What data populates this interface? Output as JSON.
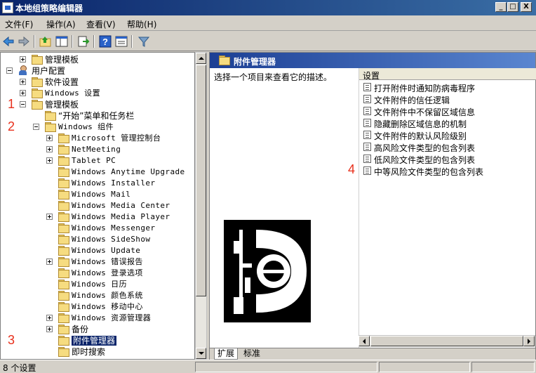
{
  "window": {
    "title": "本地组策略编辑器",
    "controls": {
      "minimize": "_",
      "maximize": "□",
      "close": "X"
    }
  },
  "menu": [
    {
      "label": "文件(F)"
    },
    {
      "label": "操作(A)"
    },
    {
      "label": "查看(V)"
    },
    {
      "label": "帮助(H)"
    }
  ],
  "toolbar": [
    "back-icon",
    "forward-icon",
    "up-folder-icon",
    "show-hide-tree-icon",
    "export-list-icon",
    "help-icon",
    "extended-view-icon",
    "filter-icon"
  ],
  "tree": {
    "nodes": [
      {
        "label": "管理模板",
        "indent": 1,
        "expander": "plus",
        "icon": "folder",
        "mono": false
      },
      {
        "label": "用户配置",
        "indent": 0,
        "expander": "minus",
        "icon": "user",
        "mono": false
      },
      {
        "label": "软件设置",
        "indent": 1,
        "expander": "plus",
        "icon": "folder",
        "mono": false
      },
      {
        "label": "Windows 设置",
        "indent": 1,
        "expander": "plus",
        "icon": "folder",
        "mono": true
      },
      {
        "label": "管理模板",
        "indent": 1,
        "expander": "minus",
        "icon": "folder",
        "mono": false
      },
      {
        "label": "“开始”菜单和任务栏",
        "indent": 2,
        "expander": "none",
        "icon": "folder",
        "mono": false
      },
      {
        "label": "Windows 组件",
        "indent": 2,
        "expander": "minus",
        "icon": "folder",
        "mono": true
      },
      {
        "label": "Microsoft 管理控制台",
        "indent": 3,
        "expander": "plus",
        "icon": "folder",
        "mono": true
      },
      {
        "label": "NetMeeting",
        "indent": 3,
        "expander": "plus",
        "icon": "folder",
        "mono": true
      },
      {
        "label": "Tablet PC",
        "indent": 3,
        "expander": "plus",
        "icon": "folder",
        "mono": true
      },
      {
        "label": "Windows Anytime Upgrade",
        "indent": 3,
        "expander": "none",
        "icon": "folder",
        "mono": true
      },
      {
        "label": "Windows Installer",
        "indent": 3,
        "expander": "none",
        "icon": "folder",
        "mono": true
      },
      {
        "label": "Windows Mail",
        "indent": 3,
        "expander": "none",
        "icon": "folder",
        "mono": true
      },
      {
        "label": "Windows Media Center",
        "indent": 3,
        "expander": "none",
        "icon": "folder",
        "mono": true
      },
      {
        "label": "Windows Media Player",
        "indent": 3,
        "expander": "plus",
        "icon": "folder",
        "mono": true
      },
      {
        "label": "Windows Messenger",
        "indent": 3,
        "expander": "none",
        "icon": "folder",
        "mono": true
      },
      {
        "label": "Windows SideShow",
        "indent": 3,
        "expander": "none",
        "icon": "folder",
        "mono": true
      },
      {
        "label": "Windows Update",
        "indent": 3,
        "expander": "none",
        "icon": "folder",
        "mono": true
      },
      {
        "label": "Windows 错误报告",
        "indent": 3,
        "expander": "plus",
        "icon": "folder",
        "mono": true
      },
      {
        "label": "Windows 登录选项",
        "indent": 3,
        "expander": "none",
        "icon": "folder",
        "mono": true
      },
      {
        "label": "Windows 日历",
        "indent": 3,
        "expander": "none",
        "icon": "folder",
        "mono": true
      },
      {
        "label": "Windows 颜色系统",
        "indent": 3,
        "expander": "none",
        "icon": "folder",
        "mono": true
      },
      {
        "label": "Windows 移动中心",
        "indent": 3,
        "expander": "none",
        "icon": "folder",
        "mono": true
      },
      {
        "label": "Windows 资源管理器",
        "indent": 3,
        "expander": "plus",
        "icon": "folder",
        "mono": true
      },
      {
        "label": "备份",
        "indent": 3,
        "expander": "plus",
        "icon": "folder",
        "mono": false
      },
      {
        "label": "附件管理器",
        "indent": 3,
        "expander": "none",
        "icon": "folder",
        "mono": false,
        "selected": true
      },
      {
        "label": "即时搜索",
        "indent": 3,
        "expander": "none",
        "icon": "folder",
        "mono": false
      }
    ],
    "annotations": [
      {
        "text": "1",
        "row": 4
      },
      {
        "text": "2",
        "row": 6
      },
      {
        "text": "3",
        "row": 25
      }
    ]
  },
  "right": {
    "header_title": "附件管理器",
    "description": "选择一个项目来查看它的描述。",
    "column_header": "设置",
    "settings": [
      "打开附件时通知防病毒程序",
      "文件附件的信任逻辑",
      "文件附件中不保留区域信息",
      "隐藏删除区域信息的机制",
      "文件附件的默认风险级别",
      "高风险文件类型的包含列表",
      "低风险文件类型的包含列表",
      "中等风险文件类型的包含列表"
    ],
    "annotation": {
      "text": "4",
      "row": 7
    },
    "tabs": [
      {
        "label": "扩展",
        "active": true
      },
      {
        "label": "标准",
        "active": false
      }
    ]
  },
  "status": {
    "text": "8 个设置"
  },
  "colors": {
    "title_bar": "#0a246a",
    "selection": "#0a246a",
    "annotation": "#e8301c"
  }
}
